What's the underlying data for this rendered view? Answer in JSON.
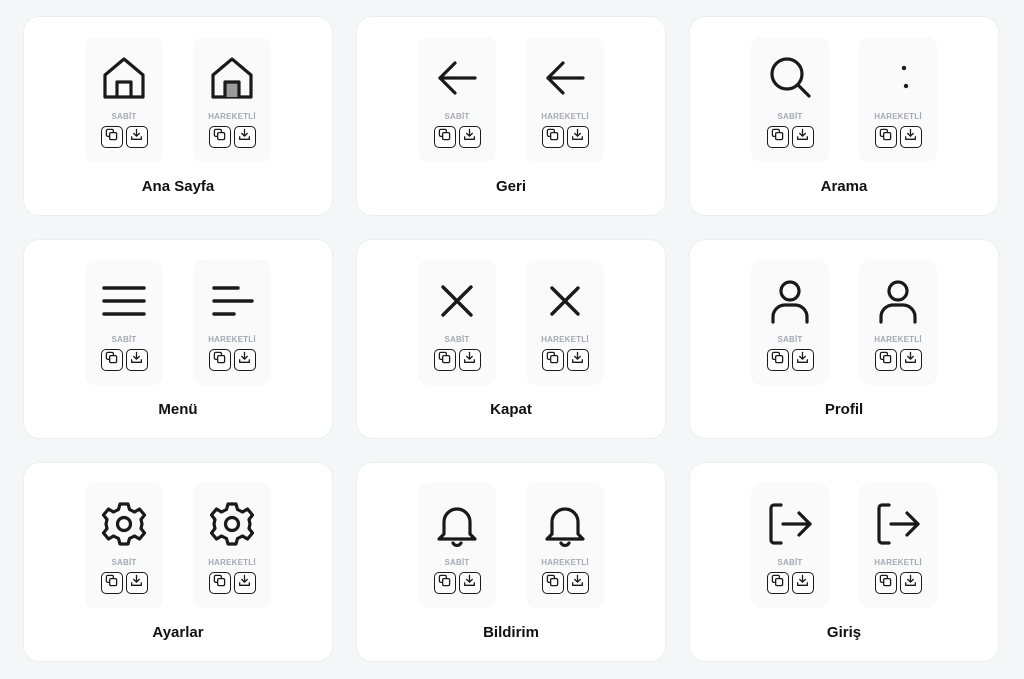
{
  "cards": [
    {
      "title": "Ana Sayfa",
      "icon": "home-icon"
    },
    {
      "title": "Geri",
      "icon": "arrow-left-icon"
    },
    {
      "title": "Arama",
      "icon": "search-icon"
    },
    {
      "title": "Menü",
      "icon": "menu-icon"
    },
    {
      "title": "Kapat",
      "icon": "close-icon"
    },
    {
      "title": "Profil",
      "icon": "user-icon"
    },
    {
      "title": "Ayarlar",
      "icon": "gear-icon"
    },
    {
      "title": "Bildirim",
      "icon": "bell-icon"
    },
    {
      "title": "Giriş",
      "icon": "login-icon"
    }
  ],
  "variants": {
    "static_label": "SABİT",
    "animated_label": "HAREKETLİ"
  },
  "actions": {
    "copy_icon": "copy-icon",
    "download_icon": "download-icon"
  },
  "colors": {
    "background": "#f5f6f8",
    "card": "#ffffff",
    "icon_stroke": "#1a1a1a",
    "variant_label": "#a3a9b6"
  }
}
